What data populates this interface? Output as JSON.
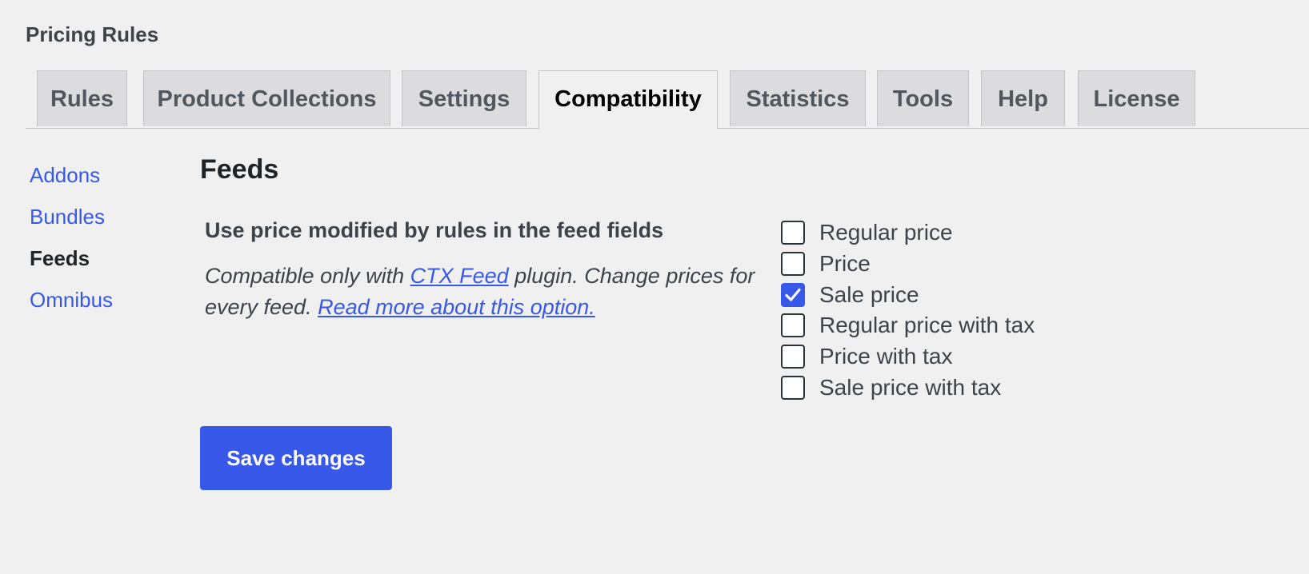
{
  "header": {
    "title": "Pricing Rules"
  },
  "tabs": [
    {
      "label": "Rules"
    },
    {
      "label": "Product Collections"
    },
    {
      "label": "Settings"
    },
    {
      "label": "Compatibility",
      "active": true
    },
    {
      "label": "Statistics"
    },
    {
      "label": "Tools"
    },
    {
      "label": "Help"
    },
    {
      "label": "License"
    }
  ],
  "sidebar": {
    "items": [
      {
        "label": "Addons"
      },
      {
        "label": "Bundles"
      },
      {
        "label": "Feeds",
        "current": true
      },
      {
        "label": "Omnibus"
      }
    ]
  },
  "main": {
    "section_title": "Feeds",
    "field": {
      "label": "Use price modified by rules in the feed fields",
      "desc_prefix": "Compatible only with ",
      "desc_link1": "CTX Feed",
      "desc_middle": " plugin. Change prices for every feed. ",
      "desc_link2": "Read more about this option."
    },
    "options": [
      {
        "label": "Regular price",
        "checked": false
      },
      {
        "label": "Price",
        "checked": false
      },
      {
        "label": "Sale price",
        "checked": true
      },
      {
        "label": "Regular price with tax",
        "checked": false
      },
      {
        "label": "Price with tax",
        "checked": false
      },
      {
        "label": "Sale price with tax",
        "checked": false
      }
    ],
    "save_label": "Save changes"
  },
  "colors": {
    "accent": "#3858e9",
    "background": "#f0f0f1",
    "tab_inactive": "#dcdcde"
  }
}
